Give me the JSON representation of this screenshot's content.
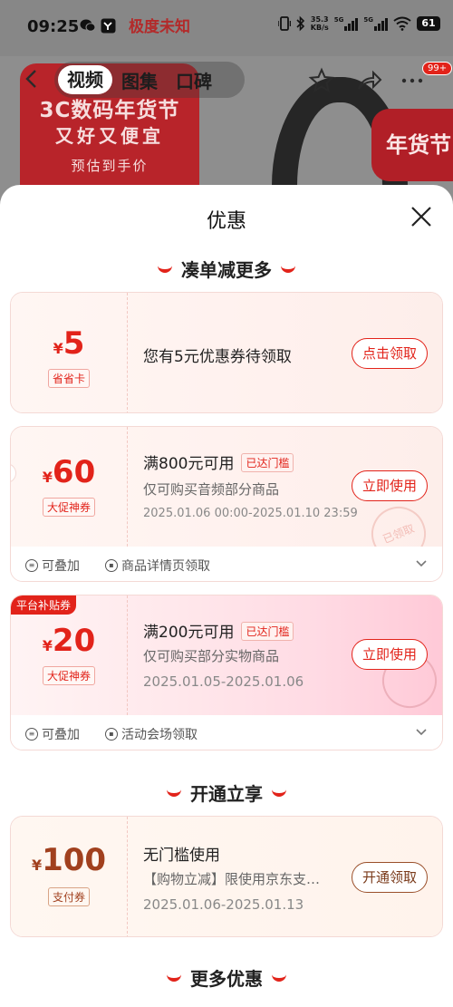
{
  "status_bar": {
    "time": "09:25",
    "app_title": "极度未知",
    "net_speed_value": "35.3",
    "net_speed_unit": "KB/s",
    "sig1": "5G",
    "sig2": "5G",
    "battery": "61"
  },
  "background": {
    "promo_line1": "3C数码年货节",
    "promo_line2": "又好又便宜",
    "promo_line3": "预估到手价",
    "badge_right": "年货节"
  },
  "top_nav": {
    "tabs": [
      "视频",
      "图集",
      "口碑"
    ],
    "more_badge": "99+"
  },
  "sheet": {
    "title": "优惠",
    "sections": {
      "s1": "凑单减更多",
      "s2": "开通立享",
      "s3": "更多优惠"
    },
    "coupons": [
      {
        "yen": "¥",
        "amount": "5",
        "tag": "省省卡",
        "title": "您有5元优惠券待领取",
        "button": "点击领取"
      },
      {
        "yen": "¥",
        "amount": "60",
        "tag": "大促神券",
        "title": "满800元可用",
        "threshold": "已达门槛",
        "sub": "仅可购买音频部分商品",
        "date": "2025.01.06 00:00-2025.01.10 23:59",
        "button": "立即使用",
        "stamp": "已领取",
        "footer_stack": "可叠加",
        "footer_source": "商品详情页领取"
      },
      {
        "platform_tag": "平台补贴券",
        "yen": "¥",
        "amount": "20",
        "tag": "大促神券",
        "title": "满200元可用",
        "threshold": "已达门槛",
        "sub": "仅可购买部分实物商品",
        "date": "2025.01.05-2025.01.06",
        "button": "立即使用",
        "footer_stack": "可叠加",
        "footer_source": "活动会场领取"
      },
      {
        "yen": "¥",
        "amount": "100",
        "tag": "支付券",
        "title": "无门槛使用",
        "sub": "【购物立减】限使用京东支…",
        "date": "2025.01.06-2025.01.13",
        "button": "开通领取"
      }
    ]
  },
  "colors": {
    "accent": "#e2231a",
    "brown": "#7a3a1a"
  }
}
